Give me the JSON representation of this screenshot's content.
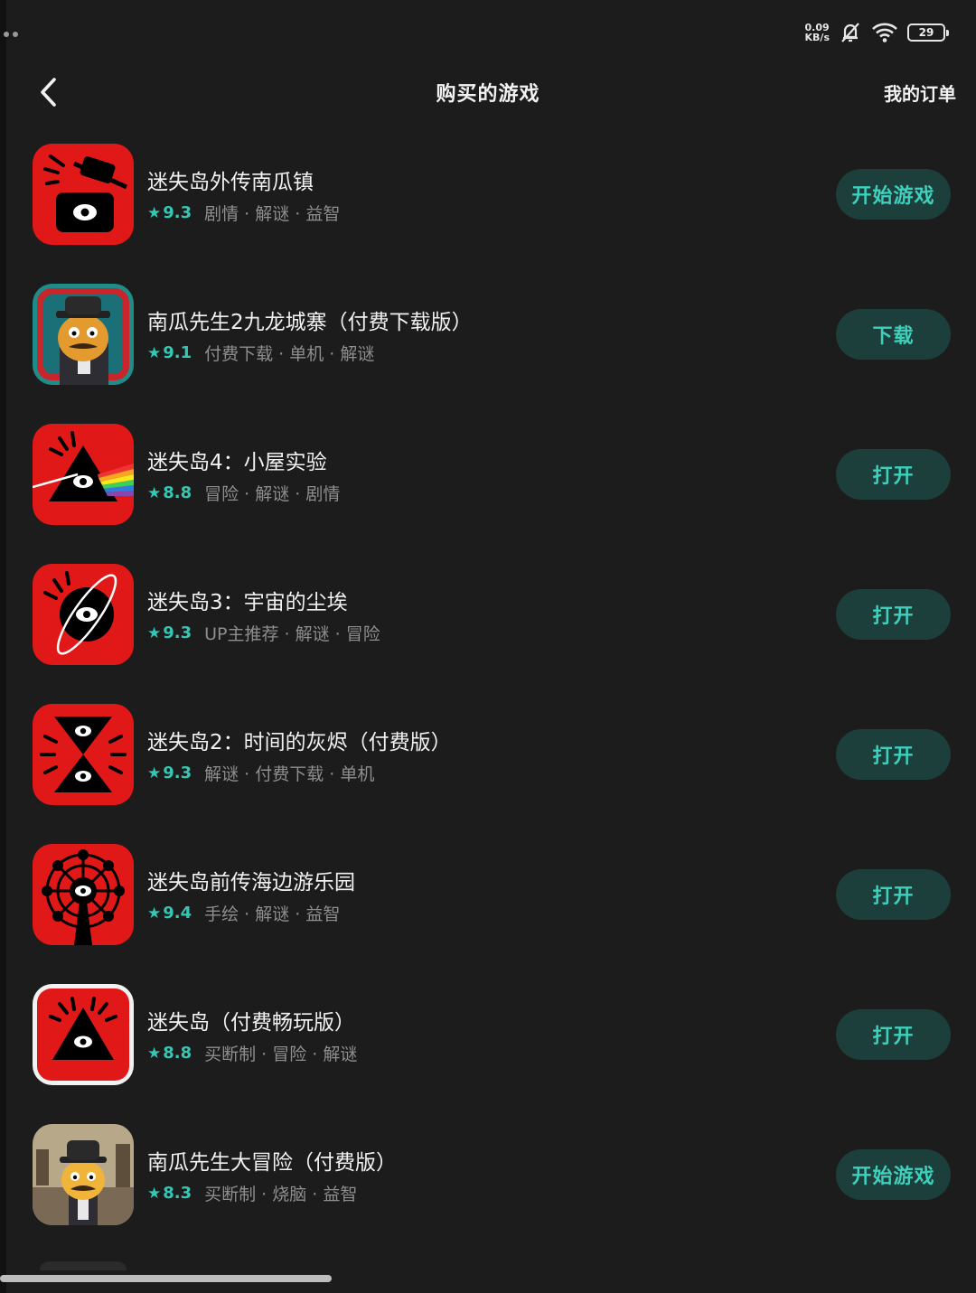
{
  "status_bar": {
    "net_speed_value": "0.09",
    "net_speed_unit": "KB/s",
    "battery": "29"
  },
  "header": {
    "title": "购买的游戏",
    "orders_link": "我的订单"
  },
  "games": [
    {
      "name": "迷失岛外传南瓜镇",
      "rating": "9.3",
      "tags": "剧情 · 解谜 · 益智",
      "action": "开始游戏"
    },
    {
      "name": "南瓜先生2九龙城寨（付费下载版）",
      "rating": "9.1",
      "tags": "付费下载 · 单机 · 解谜",
      "action": "下载"
    },
    {
      "name": "迷失岛4：小屋实验",
      "rating": "8.8",
      "tags": "冒险 · 解谜 · 剧情",
      "action": "打开"
    },
    {
      "name": "迷失岛3：宇宙的尘埃",
      "rating": "9.3",
      "tags": "UP主推荐 · 解谜 · 冒险",
      "action": "打开"
    },
    {
      "name": "迷失岛2：时间的灰烬（付费版）",
      "rating": "9.3",
      "tags": "解谜 · 付费下载 · 单机",
      "action": "打开"
    },
    {
      "name": "迷失岛前传海边游乐园",
      "rating": "9.4",
      "tags": "手绘 · 解谜 · 益智",
      "action": "打开"
    },
    {
      "name": "迷失岛（付费畅玩版）",
      "rating": "8.8",
      "tags": "买断制 · 冒险 · 解谜",
      "action": "打开"
    },
    {
      "name": "南瓜先生大冒险（付费版）",
      "rating": "8.3",
      "tags": "买断制 · 烧脑 · 益智",
      "action": "开始游戏"
    }
  ],
  "colors": {
    "background": "#1c1c1c",
    "accent": "#36c7b4",
    "button_bg": "#1d3f3b",
    "icon_red": "#e01818"
  }
}
